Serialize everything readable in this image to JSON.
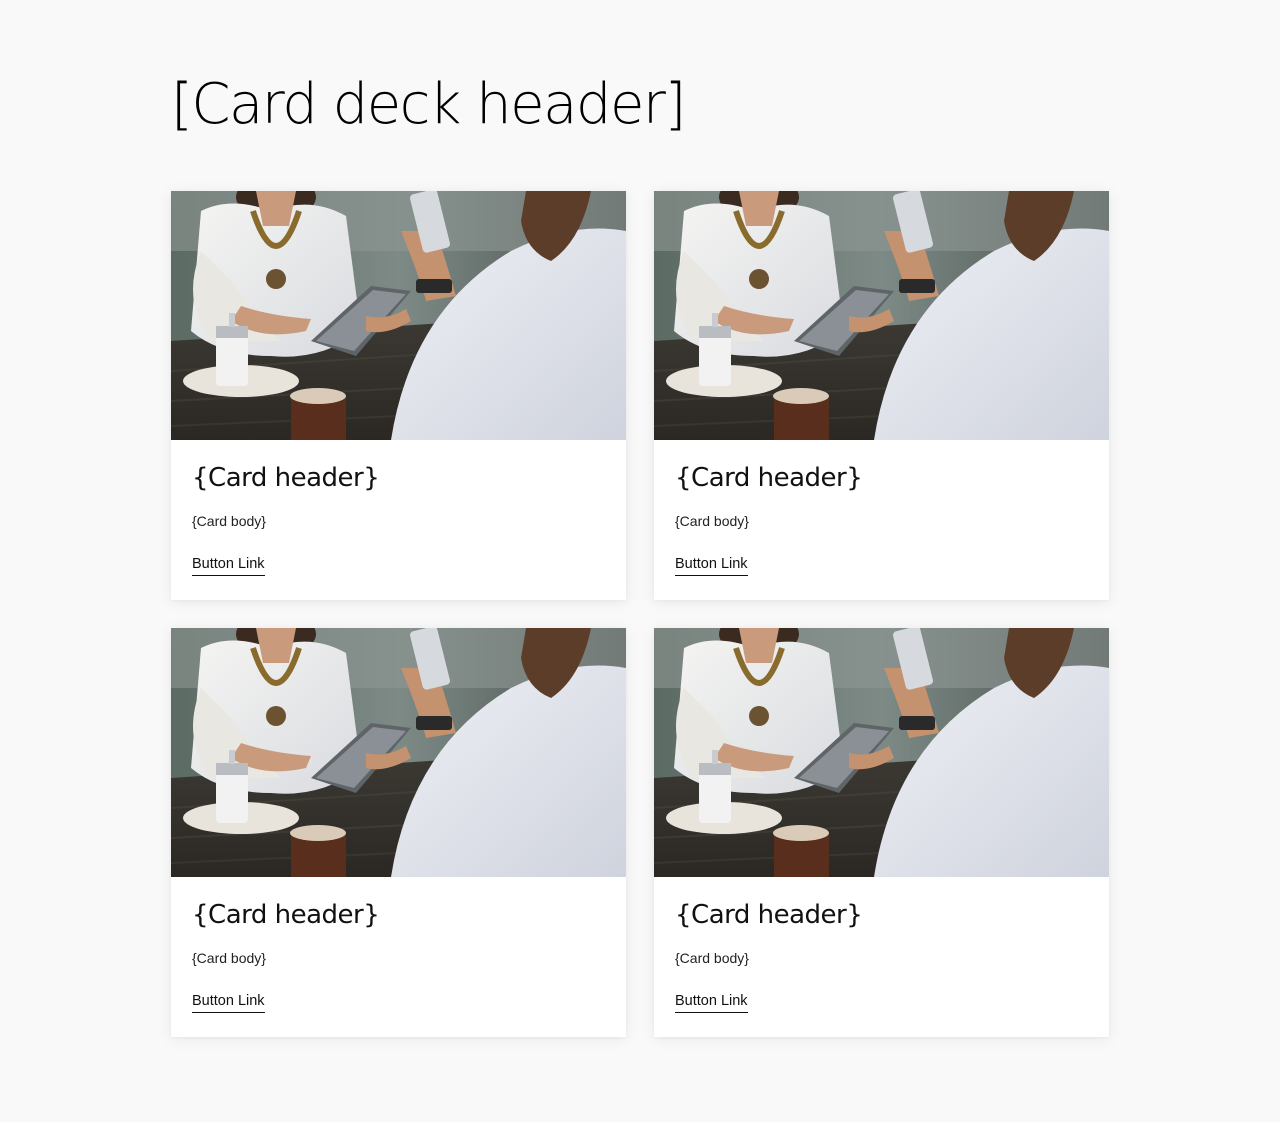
{
  "deck": {
    "title": "[Card deck header]"
  },
  "cards": [
    {
      "header": "{Card header}",
      "body": "{Card body}",
      "link": "Button Link",
      "image": "cafe-photo"
    },
    {
      "header": "{Card header}",
      "body": "{Card body}",
      "link": "Button Link",
      "image": "cafe-photo"
    },
    {
      "header": "{Card header}",
      "body": "{Card body}",
      "link": "Button Link",
      "image": "cafe-photo"
    },
    {
      "header": "{Card header}",
      "body": "{Card body}",
      "link": "Button Link",
      "image": "cafe-photo"
    }
  ]
}
